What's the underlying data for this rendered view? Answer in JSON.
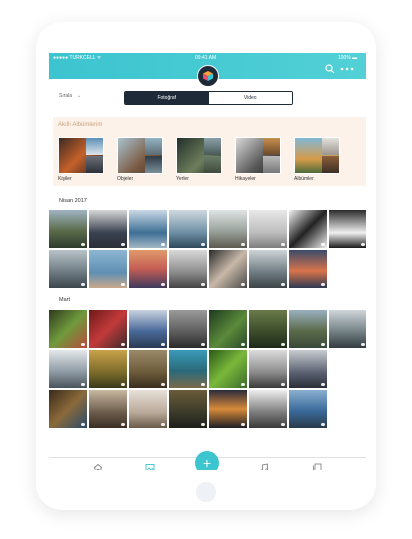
{
  "status": {
    "carrier": "●●●●● TURKCELL ᯤ",
    "time": "09:41 AM",
    "battery": "100% ▬"
  },
  "toolbar": {
    "sort_label": "Sırala",
    "sort_caret": "⌄",
    "tabs": [
      "Fotoğraf",
      "Video"
    ]
  },
  "smart_albums": {
    "title": "Akıllı Albümlerim",
    "items": [
      {
        "label": "Kişiler"
      },
      {
        "label": "Objeler"
      },
      {
        "label": "Yerler"
      },
      {
        "label": "Hikayeler"
      },
      {
        "label": "Albümler"
      }
    ]
  },
  "sections": [
    {
      "title": "Nisan 2017"
    },
    {
      "title": "Mart"
    }
  ],
  "tabbar": {
    "fab_label": "+"
  },
  "icons": [
    "search-icon",
    "more-icon",
    "home-icon",
    "gallery-icon",
    "music-icon",
    "documents-icon"
  ]
}
